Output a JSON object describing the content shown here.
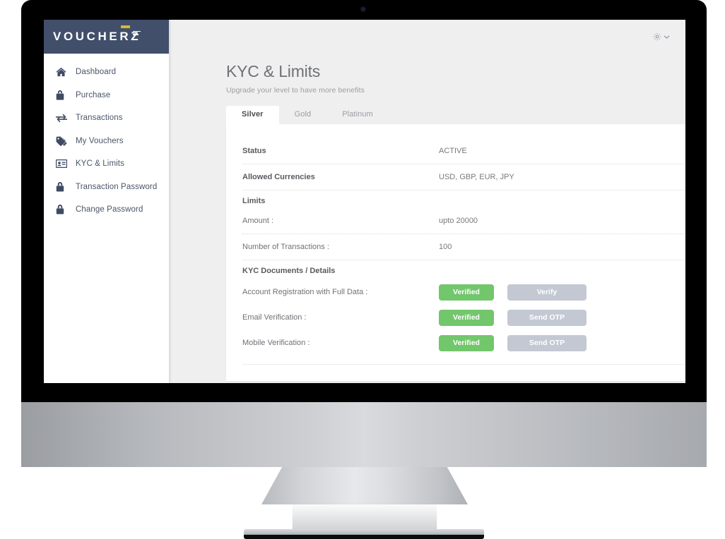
{
  "device": {
    "type": "desktop-monitor"
  },
  "brand": {
    "name": "VOUCHERZ",
    "navy": "#414f6b",
    "accent": "#d4b92e"
  },
  "sidebar": {
    "items": [
      {
        "label": "Dashboard",
        "icon": "home-icon"
      },
      {
        "label": "Purchase",
        "icon": "bag-icon"
      },
      {
        "label": "Transactions",
        "icon": "exchange-arrows-icon"
      },
      {
        "label": "My Vouchers",
        "icon": "tags-icon"
      },
      {
        "label": "KYC & Limits",
        "icon": "id-card-icon"
      },
      {
        "label": "Transaction Password",
        "icon": "lock-icon"
      },
      {
        "label": "Change Password",
        "icon": "lock-icon"
      }
    ]
  },
  "topbar": {
    "settings_icon": "gear-icon",
    "caret_icon": "chevron-down-icon"
  },
  "page": {
    "title": "KYC & Limits",
    "subtitle": "Upgrade your level to have more benefits"
  },
  "tabs": [
    {
      "label": "Silver",
      "active": true
    },
    {
      "label": "Gold",
      "active": false
    },
    {
      "label": "Platinum",
      "active": false
    }
  ],
  "card": {
    "rows": [
      {
        "label": "Status",
        "value": "ACTIVE"
      },
      {
        "label": "Allowed Currencies",
        "value": "USD, GBP, EUR, JPY"
      }
    ],
    "limits": {
      "heading": "Limits",
      "amount_label": "Amount :",
      "amount_value": "upto 20000",
      "transactions_label": "Number of Transactions :",
      "transactions_value": "100"
    },
    "kyc": {
      "heading": "KYC Documents / Details",
      "items": [
        {
          "label": "Account Registration with Full Data :",
          "status": "Verified",
          "action": "Verify"
        },
        {
          "label": "Email Verification :",
          "status": "Verified",
          "action": "Send OTP"
        },
        {
          "label": "Mobile Verification :",
          "status": "Verified",
          "action": "Send OTP"
        }
      ]
    }
  },
  "colors": {
    "verified_green": "#72c66b",
    "disabled_button": "#c3c8d3",
    "page_background": "#efefef",
    "card_background": "#ffffff"
  }
}
